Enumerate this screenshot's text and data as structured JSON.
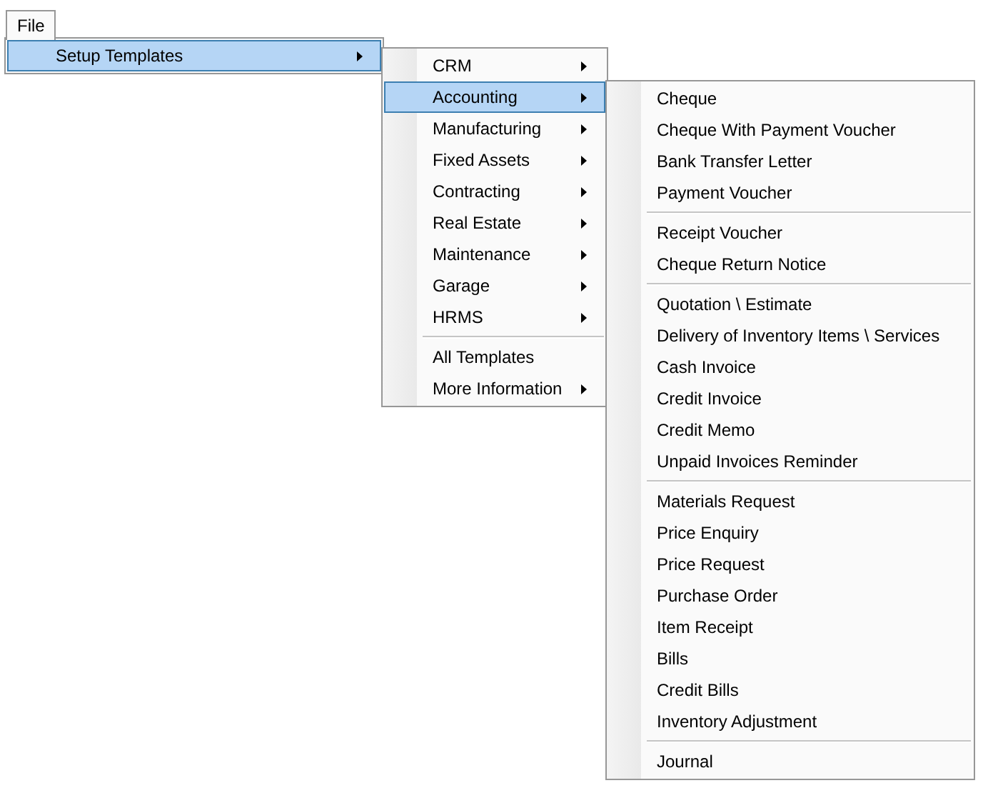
{
  "menu_bar": [
    {
      "label": "File",
      "selected": true
    }
  ],
  "menus": [
    {
      "groups": [
        {
          "items": [
            {
              "label": "Setup Templates",
              "has_submenu": true,
              "selected": true
            }
          ]
        }
      ]
    },
    {
      "groups": [
        {
          "items": [
            {
              "label": "CRM",
              "has_submenu": true,
              "selected": false
            },
            {
              "label": "Accounting",
              "has_submenu": true,
              "selected": true
            },
            {
              "label": "Manufacturing",
              "has_submenu": true,
              "selected": false
            },
            {
              "label": "Fixed Assets",
              "has_submenu": true,
              "selected": false
            },
            {
              "label": "Contracting",
              "has_submenu": true,
              "selected": false
            },
            {
              "label": "Real Estate",
              "has_submenu": true,
              "selected": false
            },
            {
              "label": "Maintenance",
              "has_submenu": true,
              "selected": false
            },
            {
              "label": "Garage",
              "has_submenu": true,
              "selected": false
            },
            {
              "label": "HRMS",
              "has_submenu": true,
              "selected": false
            }
          ]
        },
        {
          "items": [
            {
              "label": "All Templates",
              "has_submenu": false,
              "selected": false
            },
            {
              "label": "More Information",
              "has_submenu": true,
              "selected": false
            }
          ]
        }
      ]
    },
    {
      "groups": [
        {
          "items": [
            {
              "label": "Cheque",
              "has_submenu": false,
              "selected": false
            },
            {
              "label": "Cheque With Payment Voucher",
              "has_submenu": false,
              "selected": false
            },
            {
              "label": "Bank Transfer Letter",
              "has_submenu": false,
              "selected": false
            },
            {
              "label": "Payment Voucher",
              "has_submenu": false,
              "selected": false
            }
          ]
        },
        {
          "items": [
            {
              "label": "Receipt Voucher",
              "has_submenu": false,
              "selected": false
            },
            {
              "label": "Cheque Return Notice",
              "has_submenu": false,
              "selected": false
            }
          ]
        },
        {
          "items": [
            {
              "label": "Quotation \\ Estimate",
              "has_submenu": false,
              "selected": false
            },
            {
              "label": "Delivery of Inventory Items \\ Services",
              "has_submenu": false,
              "selected": false
            },
            {
              "label": "Cash Invoice",
              "has_submenu": false,
              "selected": false
            },
            {
              "label": "Credit Invoice",
              "has_submenu": false,
              "selected": false
            },
            {
              "label": "Credit Memo",
              "has_submenu": false,
              "selected": false
            },
            {
              "label": "Unpaid Invoices Reminder",
              "has_submenu": false,
              "selected": false
            }
          ]
        },
        {
          "items": [
            {
              "label": "Materials Request",
              "has_submenu": false,
              "selected": false
            },
            {
              "label": "Price Enquiry",
              "has_submenu": false,
              "selected": false
            },
            {
              "label": "Price Request",
              "has_submenu": false,
              "selected": false
            },
            {
              "label": "Purchase Order",
              "has_submenu": false,
              "selected": false
            },
            {
              "label": "Item Receipt",
              "has_submenu": false,
              "selected": false
            },
            {
              "label": "Bills",
              "has_submenu": false,
              "selected": false
            },
            {
              "label": "Credit Bills",
              "has_submenu": false,
              "selected": false
            },
            {
              "label": "Inventory Adjustment",
              "has_submenu": false,
              "selected": false
            }
          ]
        },
        {
          "items": [
            {
              "label": "Journal",
              "has_submenu": false,
              "selected": false
            }
          ]
        }
      ]
    }
  ]
}
